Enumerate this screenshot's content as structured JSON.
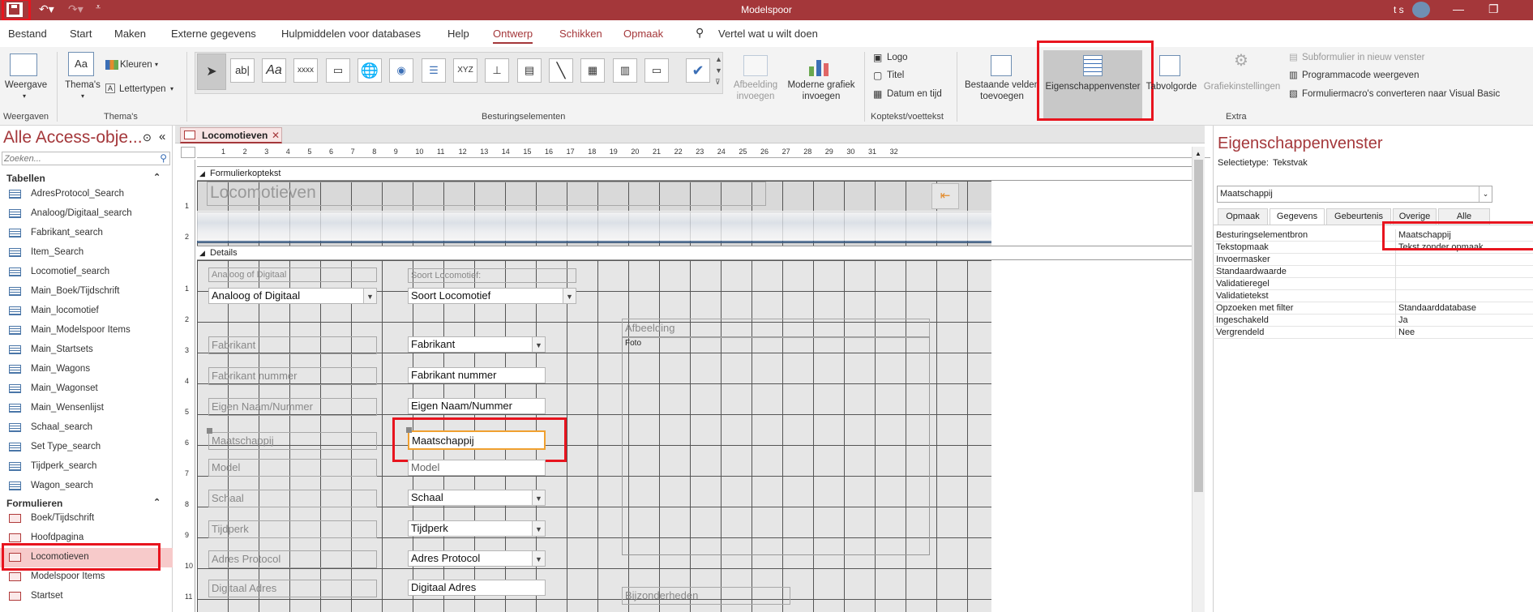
{
  "app": {
    "title": "Modelspoor",
    "user": "t s"
  },
  "menu": [
    "Bestand",
    "Start",
    "Maken",
    "Externe gegevens",
    "Hulpmiddelen voor databases",
    "Help",
    "Ontwerp",
    "Schikken",
    "Opmaak"
  ],
  "tell_me": "Vertel wat u wilt doen",
  "ribbon": {
    "weergave": "Weergave",
    "themas": "Thema's",
    "kleuren": "Kleuren",
    "lettertypen": "Lettertypen",
    "group_weergaven": "Weergaven",
    "group_themas": "Thema's",
    "group_besturing": "Besturingselementen",
    "afbeelding": "Afbeelding invoegen",
    "grafiek": "Moderne grafiek invoegen",
    "logo": "Logo",
    "titel": "Titel",
    "datum": "Datum en tijd",
    "group_koptekst": "Koptekst/voettekst",
    "bestaande": "Bestaande velden toevoegen",
    "eigenschappen": "Eigenschappenvenster",
    "tabvolgorde": "Tabvolgorde",
    "grafiekinst": "Grafiekinstellingen",
    "subformulier": "Subformulier in nieuw venster",
    "programmacode": "Programmacode weergeven",
    "converteren": "Formuliermacro's converteren naar Visual Basic",
    "group_extra": "Extra",
    "tools": [
      "ab|",
      "Aa",
      "xxxx",
      "XYZ"
    ]
  },
  "nav": {
    "title": "Alle Access-obje...",
    "search_placeholder": "Zoeken...",
    "sec_tabellen": "Tabellen",
    "tabellen": [
      "AdresProtocol_Search",
      "Analoog/Digitaal_search",
      "Fabrikant_search",
      "Item_Search",
      "Locomotief_search",
      "Main_Boek/Tijdschrift",
      "Main_locomotief",
      "Main_Modelspoor Items",
      "Main_Startsets",
      "Main_Wagons",
      "Main_Wagonset",
      "Main_Wensenlijst",
      "Schaal_search",
      "Set Type_search",
      "Tijdperk_search",
      "Wagon_search"
    ],
    "sec_formulieren": "Formulieren",
    "formulieren": [
      "Boek/Tijdschrift",
      "Hoofdpagina",
      "Locomotieven",
      "Modelspoor Items",
      "Startset"
    ]
  },
  "doc": {
    "tab": "Locomotieven",
    "ruler_h": [
      "1",
      "2",
      "3",
      "4",
      "5",
      "6",
      "7",
      "8",
      "9",
      "10",
      "11",
      "12",
      "13",
      "14",
      "15",
      "16",
      "17",
      "18",
      "19",
      "20",
      "21",
      "22",
      "23",
      "24",
      "25",
      "26",
      "27",
      "28",
      "29",
      "30",
      "31",
      "32"
    ],
    "ruler_v_head": [
      "1",
      "2"
    ],
    "ruler_v_detail": [
      "1",
      "2",
      "3",
      "4",
      "5",
      "6",
      "7",
      "8",
      "9",
      "10",
      "11"
    ],
    "header_section": "Formulierkoptekst",
    "form_title": "Locomotieven",
    "detail_section": "Details",
    "labels": [
      "Analoog of Digitaal",
      "Soort Locomotief:",
      "Afbeelding",
      "Fabrikant",
      "Fabrikant nummer",
      "Eigen Naam/Nummer",
      "Maatschappij",
      "Model",
      "Schaal",
      "Tijdperk",
      "Adres Protocol",
      "Digitaal Adres",
      "Bijzonderheden"
    ],
    "fields": [
      "Analoog of Digitaal",
      "Soort Locomotief",
      "Fabrikant",
      "Fabrikant nummer",
      "Eigen Naam/Nummer",
      "Maatschappij",
      "Model",
      "Schaal",
      "Tijdperk",
      "Adres Protocol",
      "Digitaal Adres",
      "Foto"
    ]
  },
  "props": {
    "title": "Eigenschappenvenster",
    "sel_label": "Selectietype:",
    "sel_value": "Tekstvak",
    "object": "Maatschappij",
    "tabs": [
      "Opmaak",
      "Gegevens",
      "Gebeurtenis",
      "Overige",
      "Alle"
    ],
    "rows": [
      {
        "k": "Besturingselementbron",
        "v": "Maatschappij"
      },
      {
        "k": "Tekstopmaak",
        "v": "Tekst zonder opmaak"
      },
      {
        "k": "Invoermasker",
        "v": ""
      },
      {
        "k": "Standaardwaarde",
        "v": ""
      },
      {
        "k": "Validatieregel",
        "v": ""
      },
      {
        "k": "Validatietekst",
        "v": ""
      },
      {
        "k": "Opzoeken met filter",
        "v": "Standaarddatabase"
      },
      {
        "k": "Ingeschakeld",
        "v": "Ja"
      },
      {
        "k": "Vergrendeld",
        "v": "Nee"
      }
    ]
  }
}
